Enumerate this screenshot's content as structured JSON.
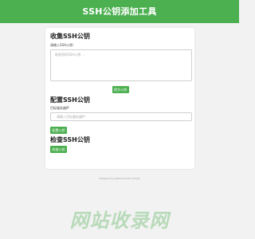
{
  "header": {
    "title": "SSH公钥添加工具"
  },
  "collect": {
    "title": "收集SSH公钥",
    "input_label": "请输入SSH公钥：",
    "input_placeholder": "粘贴您的SSH公钥 ...",
    "input_value": "",
    "submit_label": "提交公钥"
  },
  "configure": {
    "title": "配置SSH公钥",
    "input_label": "目标服务器IP",
    "input_placeholder": "请输入目标服务器IP",
    "input_value": "",
    "button_label": "配置公钥"
  },
  "check": {
    "title": "检查SSH公钥",
    "button_label": "检查公钥"
  },
  "footer": {
    "credit": "designed by beihuxia with ai tools"
  },
  "watermark": {
    "text": "网站收录网"
  },
  "colors": {
    "accent": "#4caf50",
    "background": "#f2f2f2",
    "card": "#ffffff"
  }
}
